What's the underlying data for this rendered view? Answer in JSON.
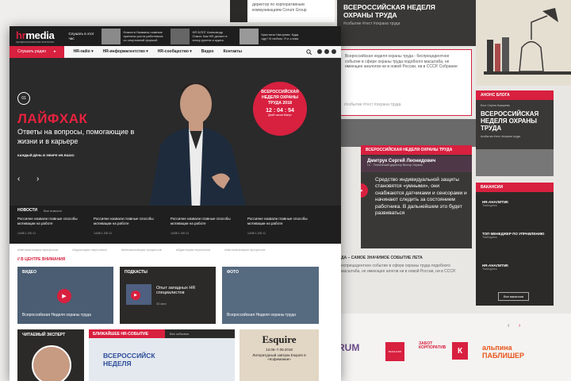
{
  "bg": {
    "top_caption": "директор по корпоративным коммуникациям Corum Group",
    "week_title": "ВСЕРОССИЙСКАЯ НЕДЕЛЯ ОХРАНЫ ТРУДА",
    "week_tags": "#событие  #тест  #охрана труда",
    "quote_text": "Всероссийская неделя охраны труда - беспрецедентное событие в сфере охраны труда подобного масштаба, не имеющее аналогов ни в новой России, ни в СССР. Собрание",
    "quote_tags": "#событие  #тест  #охрана труда",
    "red_caption": "ВСЕРОССИЙСКАЯ НЕДЕЛЯ ОХРАНЫ ТРУДА",
    "person_name": "Дмитрук Сергей Леонидович",
    "person_role": "г.с. - Технический директор Вектор Охраны",
    "person_quote": "Средство индивидуальной защиты становятся «умными», они снабжаются датчиками и сенсорами и начинают следить за состоянием работника. В дальнейшем это будет развиваться",
    "event_caption": "ДА – САМОЕ ЗНАЧИМОЕ СОБЫТИЕ ЛЕТА",
    "event_text": "еспрецедентное событие в сфере охраны труда подобного масштаба, не имеющее алогов ни в новой России, ни в СССР.",
    "blog_header": "АНОНС БЛОГА",
    "blog_author": "Блог Сергея Козырева",
    "blog_title": "ВСЕРОССИЙСКАЯ НЕДЕЛЯ ОХРАНЫ ТРУДА",
    "blog_tags": "#событие  #тест  #охрана труда",
    "vac_header": "ВАКАНСИИ",
    "vacancies": [
      {
        "title": "HR-АНАЛИТИК",
        "company": "Tradingview"
      },
      {
        "title": "ТОП МЕНЕДЖЕР ПО УПРАВЛЕНИЮ",
        "company": "Tradingview"
      },
      {
        "title": "HR-АНАЛИТИК",
        "company": "Tradingview"
      }
    ],
    "vac_all": "Все вакансии",
    "partners": [
      "RUM",
      "ВАКАНСИИ",
      "ЗАБОТ КОРПОРАТИВ",
      "К",
      "альпина ПАБЛИШЕР"
    ]
  },
  "header": {
    "logo": "hr",
    "logo_accent": "media",
    "logo_sub": "профессиональное агентство",
    "listen_live": "Слушать в этот час",
    "thumbs": [
      {
        "text": "Новости Названы главные причины роста работников со спортивной формой"
      },
      {
        "text": "HR БЛОГ Александр Очкин: Как HR делает в эпоху рунета и ждать"
      },
      {
        "text": "Кристина Нагорная: Куда иду? В любом: Я и слова"
      }
    ]
  },
  "nav": {
    "radio": "Слушать радио",
    "items": [
      "HR-radio ▾",
      "HR-информагентство ▾",
      "HR-сообщество ▾",
      "Видео",
      "Контакты"
    ]
  },
  "hero": {
    "number": "01",
    "title": "ЛАЙФХАК",
    "subtitle": "Ответы на вопросы, помогающие в жизни и в карьере",
    "note": "КАЖДЫЙ ДЕНЬ В ЭФИРЕ HR-RADIO",
    "badge_title": "ВСЕРОССИЙСКАЯ НЕДЕЛЯ ОХРАНЫ ТРУДА 2018",
    "countdown": "12 : 04 : 54",
    "countdown_labels": "Дней   часов   Минут"
  },
  "news": {
    "header": "НОВОСТИ",
    "all": "Все новости",
    "items": [
      "Россияне назвали главные способы мотивации на работе",
      "Россияне назвали главные способы мотивации на работе",
      "Россияне назвали главные способы мотивации на работе",
      "Россияне назвали главные способы мотивации на работе"
    ],
    "meta": "14/08   1 200   11"
  },
  "tags": [
    "#Автоматизация процессов",
    "#Адаптация персонала",
    "#Автоматизация процессов",
    "#Адаптация персонала",
    "#Автоматизация процессов"
  ],
  "attention": "// В ЦЕНТРЕ ВНИМАНИЯ",
  "tiles": {
    "video_label": "ВИДЕО",
    "video_caption": "Всероссийская Неделя охраны труда",
    "podcasts_label": "ПОДКАСТЫ",
    "podcast_title": "Опыт западных HR специалистов",
    "podcast_meta": "30 мин",
    "photo_label": "ФОТО",
    "photo_caption": "Всероссийская Неделя охраны труда"
  },
  "row3": {
    "expert_label": "ЧИТАЕМЫЙ ЭКСПЕРТ",
    "event_label": "БЛИЖАЙШЕЕ HR-СОБЫТИЕ",
    "event_all": "Все события",
    "event_banner": "ВСЕРОССИЙСК НЕДЕЛЯ",
    "esquire": "Esquire",
    "esquire_date": "13.06–7.09.2018",
    "esquire_text": "Литературный завтрак Esquire в «Кофемании»"
  }
}
